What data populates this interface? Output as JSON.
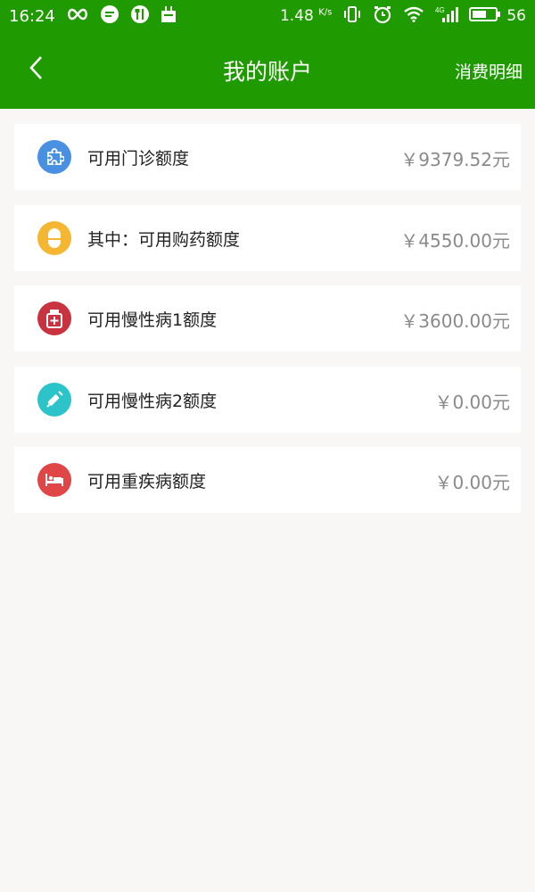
{
  "status_bar": {
    "time": "16:24",
    "speed_value": "1.48",
    "speed_unit": "K/s",
    "network": "4G",
    "battery": "56"
  },
  "header": {
    "title": "我的账户",
    "right_link": "消费明细",
    "background_color": "#1f9a00"
  },
  "accounts": [
    {
      "label": "可用门诊额度",
      "amount": "￥9379.52元",
      "icon": "puzzle-icon",
      "color": "#4a90e2"
    },
    {
      "label": "其中：可用购药额度",
      "amount": "￥4550.00元",
      "icon": "pill-icon",
      "color": "#f5b731"
    },
    {
      "label": "可用慢性病1额度",
      "amount": "￥3600.00元",
      "icon": "medicine-bottle-icon",
      "color": "#c9323f"
    },
    {
      "label": "可用慢性病2额度",
      "amount": "￥0.00元",
      "icon": "syringe-icon",
      "color": "#2cc4c8"
    },
    {
      "label": "可用重疾病额度",
      "amount": "￥0.00元",
      "icon": "hospital-bed-icon",
      "color": "#e04646"
    }
  ]
}
